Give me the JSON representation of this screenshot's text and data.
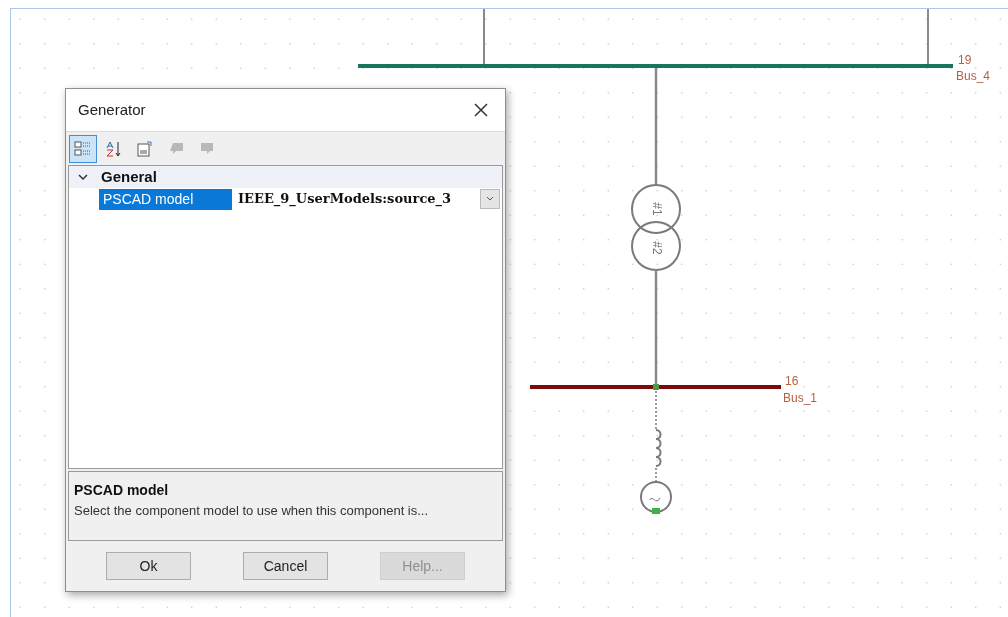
{
  "diagram": {
    "buses": [
      {
        "number": "19",
        "name": "Bus_4",
        "color": "#17765e"
      },
      {
        "number": "16",
        "name": "Bus_1",
        "color": "#7d0a0a"
      }
    ],
    "transformer": {
      "windings": [
        "#1",
        "#2"
      ]
    }
  },
  "dialog": {
    "title": "Generator",
    "toolbar": [
      {
        "kind": "categorized",
        "selected": true,
        "disabled": false
      },
      {
        "kind": "alphabetical",
        "selected": false,
        "disabled": false
      },
      {
        "kind": "pages",
        "selected": false,
        "disabled": false
      },
      {
        "kind": "back",
        "selected": false,
        "disabled": true
      },
      {
        "kind": "forward",
        "selected": false,
        "disabled": true
      }
    ],
    "category": {
      "label": "General",
      "expanded": true
    },
    "properties": [
      {
        "name": "PSCAD model",
        "value": "IEEE_9_UserModels:source_3",
        "selected": true
      }
    ],
    "description": {
      "title": "PSCAD model",
      "text": "Select the component model to use when this component is..."
    },
    "buttons": [
      {
        "label": "Ok",
        "disabled": false
      },
      {
        "label": "Cancel",
        "disabled": false
      },
      {
        "label": "Help...",
        "disabled": true
      }
    ]
  }
}
